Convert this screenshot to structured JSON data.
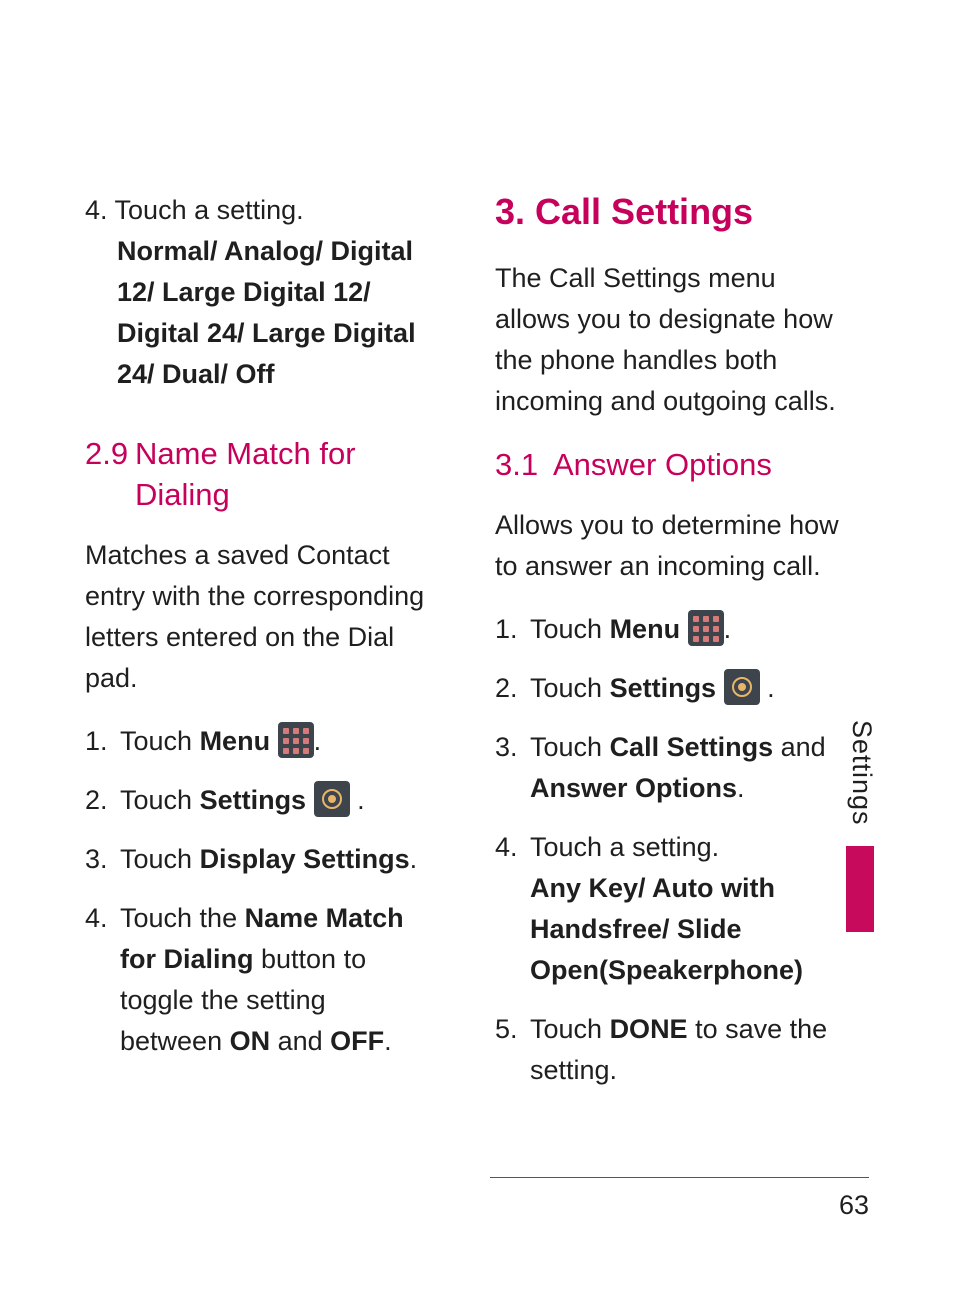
{
  "left": {
    "step4_prefix": "4. ",
    "step4_line1": "Touch a setting.",
    "step4_options": "Normal/ Analog/ Digital 12/ Large Digital 12/ Digital 24/ Large Digital 24/ Dual/ Off",
    "heading_num": "2.9",
    "heading_text": "Name Match for Dialing",
    "para": "Matches a saved Contact entry with the corresponding letters entered on the Dial pad.",
    "s1a": "Touch ",
    "s1b": "Menu",
    "s1c": ".",
    "s2a": "Touch ",
    "s2b": "Settings",
    "s2c": " .",
    "s3a": "Touch ",
    "s3b": "Display Settings",
    "s3c": ".",
    "s4a": "Touch the ",
    "s4b": "Name Match for Dialing",
    "s4c": " button to toggle the setting between ",
    "s4d": "ON",
    "s4e": " and ",
    "s4f": "OFF",
    "s4g": "."
  },
  "right": {
    "h1": "3. Call Settings",
    "intro": "The Call Settings menu allows you to designate how the phone handles both incoming and outgoing calls.",
    "h2_num": "3.1",
    "h2_text": "Answer Options",
    "para": "Allows you to determine how to answer an incoming call.",
    "s1a": "Touch ",
    "s1b": "Menu",
    "s1c": ".",
    "s2a": "Touch ",
    "s2b": "Settings",
    "s2c": " .",
    "s3a": "Touch ",
    "s3b": "Call Settings",
    "s3c": " and ",
    "s3d": "Answer Options",
    "s3e": ".",
    "s4a": "Touch a setting.",
    "s4b": "Any Key/ Auto with Handsfree/ Slide Open(Speakerphone)",
    "s5a": "Touch ",
    "s5b": "DONE",
    "s5c": " to save the setting."
  },
  "sidebar": "Settings",
  "page_number": "63"
}
